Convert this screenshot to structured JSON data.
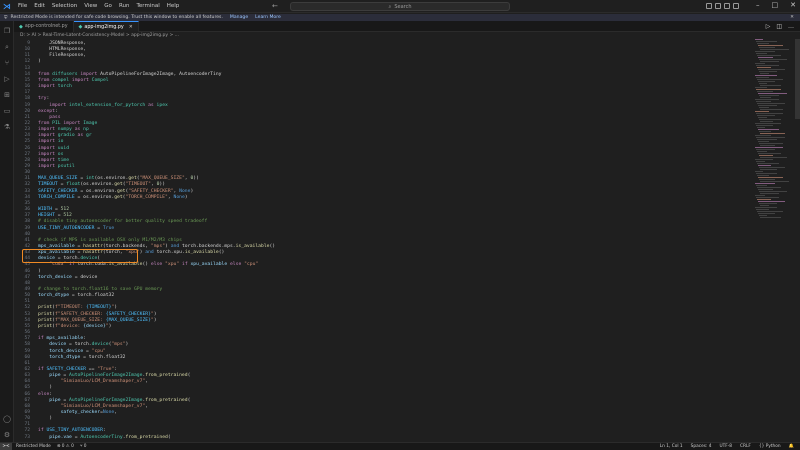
{
  "titlebar": {
    "logo": "vscode-logo",
    "menu": [
      "File",
      "Edit",
      "Selection",
      "View",
      "Go",
      "Run",
      "Terminal",
      "Help"
    ],
    "search_placeholder": "Search"
  },
  "restricted_banner": {
    "text": "Restricted Mode is intended for safe code browsing. Trust this window to enable all features.",
    "manage": "Manage",
    "learn_more": "Learn More"
  },
  "tabs": [
    {
      "label": "app-controlnet.py",
      "active": false
    },
    {
      "label": "app-img2img.py",
      "active": true
    }
  ],
  "breadcrumb": "D: > AI > Real-Time-Latent-Consistency-Model > app-img2img.py > ...",
  "status": {
    "remote": "><",
    "restricted": "Restricted Mode",
    "problems": "⊗ 0 ⚠ 0",
    "ports": "⑂ 0",
    "position": "Ln 1, Col 1",
    "spaces": "Spaces: 4",
    "encoding": "UTF-8",
    "eol": "CRLF",
    "language": "{} Python"
  },
  "code_lines": [
    {
      "n": "9",
      "t": [
        [
          "    JSONResponse,",
          "plain"
        ]
      ]
    },
    {
      "n": "10",
      "t": [
        [
          "    HTMLResponse,",
          "plain"
        ]
      ]
    },
    {
      "n": "11",
      "t": [
        [
          "    FileResponse,",
          "plain"
        ]
      ]
    },
    {
      "n": "12",
      "t": [
        [
          ")",
          "plain"
        ]
      ]
    },
    {
      "n": "13",
      "t": [
        [
          "",
          "plain"
        ]
      ]
    },
    {
      "n": "14",
      "t": [
        [
          "from ",
          "kw"
        ],
        [
          "diffusers ",
          "cls"
        ],
        [
          "import ",
          "kw"
        ],
        [
          "AutoPipelineForImage2Image, AutoencoderTiny",
          "plain"
        ]
      ]
    },
    {
      "n": "15",
      "t": [
        [
          "from ",
          "kw"
        ],
        [
          "compel ",
          "cls"
        ],
        [
          "import ",
          "kw"
        ],
        [
          "Compel",
          "cls"
        ]
      ]
    },
    {
      "n": "16",
      "t": [
        [
          "import ",
          "kw"
        ],
        [
          "torch",
          "cls"
        ]
      ]
    },
    {
      "n": "17",
      "t": [
        [
          "",
          "plain"
        ]
      ]
    },
    {
      "n": "18",
      "t": [
        [
          "try",
          "kw"
        ],
        [
          ":",
          "plain"
        ]
      ]
    },
    {
      "n": "19",
      "t": [
        [
          "    import ",
          "kw"
        ],
        [
          "intel_extension_for_pytorch ",
          "cls"
        ],
        [
          "as ",
          "kw"
        ],
        [
          "ipex",
          "cls"
        ]
      ]
    },
    {
      "n": "20",
      "t": [
        [
          "except",
          "kw"
        ],
        [
          ":",
          "plain"
        ]
      ]
    },
    {
      "n": "21",
      "t": [
        [
          "    pass",
          "kw"
        ]
      ]
    },
    {
      "n": "22",
      "t": [
        [
          "from ",
          "kw"
        ],
        [
          "PIL ",
          "cls"
        ],
        [
          "import ",
          "kw"
        ],
        [
          "Image",
          "cls"
        ]
      ]
    },
    {
      "n": "23",
      "t": [
        [
          "import ",
          "kw"
        ],
        [
          "numpy ",
          "cls"
        ],
        [
          "as ",
          "kw"
        ],
        [
          "np",
          "cls"
        ]
      ]
    },
    {
      "n": "24",
      "t": [
        [
          "import ",
          "kw"
        ],
        [
          "gradio ",
          "cls"
        ],
        [
          "as ",
          "kw"
        ],
        [
          "gr",
          "cls"
        ]
      ]
    },
    {
      "n": "25",
      "t": [
        [
          "import ",
          "kw"
        ],
        [
          "io",
          "cls"
        ]
      ]
    },
    {
      "n": "26",
      "t": [
        [
          "import ",
          "kw"
        ],
        [
          "uuid",
          "cls"
        ]
      ]
    },
    {
      "n": "27",
      "t": [
        [
          "import ",
          "kw"
        ],
        [
          "os",
          "cls"
        ]
      ]
    },
    {
      "n": "28",
      "t": [
        [
          "import ",
          "kw"
        ],
        [
          "time",
          "cls"
        ]
      ]
    },
    {
      "n": "29",
      "t": [
        [
          "import ",
          "kw"
        ],
        [
          "psutil",
          "cls"
        ]
      ]
    },
    {
      "n": "30",
      "t": [
        [
          "",
          "plain"
        ]
      ]
    },
    {
      "n": "31",
      "t": [
        [
          "MAX_QUEUE_SIZE",
          "cst"
        ],
        [
          " = ",
          "plain"
        ],
        [
          "int",
          "cls"
        ],
        [
          "(os.environ.",
          "plain"
        ],
        [
          "get",
          "fn"
        ],
        [
          "(",
          "plain"
        ],
        [
          "\"MAX_QUEUE_SIZE\"",
          "str"
        ],
        [
          ", ",
          "plain"
        ],
        [
          "0",
          "num"
        ],
        [
          "))",
          "plain"
        ]
      ]
    },
    {
      "n": "32",
      "t": [
        [
          "TIMEOUT",
          "cst"
        ],
        [
          " = ",
          "plain"
        ],
        [
          "float",
          "cls"
        ],
        [
          "(os.environ.",
          "plain"
        ],
        [
          "get",
          "fn"
        ],
        [
          "(",
          "plain"
        ],
        [
          "\"TIMEOUT\"",
          "str"
        ],
        [
          ", ",
          "plain"
        ],
        [
          "0",
          "num"
        ],
        [
          "))",
          "plain"
        ]
      ]
    },
    {
      "n": "33",
      "t": [
        [
          "SAFETY_CHECKER",
          "cst"
        ],
        [
          " = os.environ.",
          "plain"
        ],
        [
          "get",
          "fn"
        ],
        [
          "(",
          "plain"
        ],
        [
          "\"SAFETY_CHECKER\"",
          "str"
        ],
        [
          ", ",
          "plain"
        ],
        [
          "None",
          "kw2"
        ],
        [
          ")",
          "plain"
        ]
      ]
    },
    {
      "n": "34",
      "t": [
        [
          "TORCH_COMPILE",
          "cst"
        ],
        [
          " = os.environ.",
          "plain"
        ],
        [
          "get",
          "fn"
        ],
        [
          "(",
          "plain"
        ],
        [
          "\"TORCH_COMPILE\"",
          "str"
        ],
        [
          ", ",
          "plain"
        ],
        [
          "None",
          "kw2"
        ],
        [
          ")",
          "plain"
        ]
      ]
    },
    {
      "n": "35",
      "t": [
        [
          "",
          "plain"
        ]
      ]
    },
    {
      "n": "36",
      "t": [
        [
          "WIDTH",
          "cst"
        ],
        [
          " = ",
          "plain"
        ],
        [
          "512",
          "num"
        ]
      ]
    },
    {
      "n": "37",
      "t": [
        [
          "HEIGHT",
          "cst"
        ],
        [
          " = ",
          "plain"
        ],
        [
          "512",
          "num"
        ]
      ]
    },
    {
      "n": "38",
      "t": [
        [
          "# disable tiny autoencoder for better quality speed tradeoff",
          "cm"
        ]
      ]
    },
    {
      "n": "39",
      "t": [
        [
          "USE_TINY_AUTOENCODER",
          "cst"
        ],
        [
          " = ",
          "plain"
        ],
        [
          "True",
          "kw2"
        ]
      ]
    },
    {
      "n": "40",
      "t": [
        [
          "",
          "plain"
        ]
      ]
    },
    {
      "n": "41",
      "t": [
        [
          "# check if MPS is available OSX only M1/M2/M3 chips",
          "cm"
        ]
      ]
    },
    {
      "n": "42",
      "t": [
        [
          "mps_available",
          "id"
        ],
        [
          " = ",
          "plain"
        ],
        [
          "hasattr",
          "fn"
        ],
        [
          "(torch.backends, ",
          "plain"
        ],
        [
          "\"mps\"",
          "str"
        ],
        [
          ") ",
          "plain"
        ],
        [
          "and ",
          "kw2"
        ],
        [
          "torch.backends.mps.",
          "plain"
        ],
        [
          "is_available",
          "fn"
        ],
        [
          "()",
          "plain"
        ]
      ]
    },
    {
      "n": "43",
      "t": [
        [
          "xpu_available",
          "id"
        ],
        [
          " = ",
          "plain"
        ],
        [
          "hasattr",
          "fn"
        ],
        [
          "(torch, ",
          "plain"
        ],
        [
          "\"xpu\"",
          "str"
        ],
        [
          ") ",
          "plain"
        ],
        [
          "and ",
          "kw2"
        ],
        [
          "torch.xpu.",
          "plain"
        ],
        [
          "is_available",
          "fn"
        ],
        [
          "()",
          "plain"
        ]
      ]
    },
    {
      "n": "44",
      "t": [
        [
          "device",
          "id"
        ],
        [
          " = torch.",
          "plain"
        ],
        [
          "device",
          "cls"
        ],
        [
          "(",
          "plain"
        ]
      ]
    },
    {
      "n": "45",
      "t": [
        [
          "    ",
          "plain"
        ],
        [
          "\"cuda\"",
          "str"
        ],
        [
          " ",
          "plain"
        ],
        [
          "if ",
          "kw"
        ],
        [
          "torch.cuda.",
          "plain"
        ],
        [
          "is_available",
          "fn"
        ],
        [
          "() ",
          "plain"
        ],
        [
          "else ",
          "kw"
        ],
        [
          "\"xpu\"",
          "str"
        ],
        [
          " ",
          "plain"
        ],
        [
          "if ",
          "kw"
        ],
        [
          "xpu_available ",
          "id"
        ],
        [
          "else ",
          "kw"
        ],
        [
          "\"cpu\"",
          "str"
        ]
      ]
    },
    {
      "n": "46",
      "t": [
        [
          ")",
          "plain"
        ]
      ]
    },
    {
      "n": "47",
      "t": [
        [
          "torch_device",
          "id"
        ],
        [
          " = device",
          "plain"
        ]
      ]
    },
    {
      "n": "48",
      "t": [
        [
          "",
          "plain"
        ]
      ]
    },
    {
      "n": "49",
      "t": [
        [
          "# change to torch.float16 to save GPU memory",
          "cm"
        ]
      ]
    },
    {
      "n": "50",
      "t": [
        [
          "torch_dtype",
          "id"
        ],
        [
          " = torch.float32",
          "plain"
        ]
      ]
    },
    {
      "n": "51",
      "t": [
        [
          "",
          "plain"
        ]
      ]
    },
    {
      "n": "52",
      "t": [
        [
          "print",
          "fn"
        ],
        [
          "(",
          "plain"
        ],
        [
          "f\"TIMEOUT: ",
          "str"
        ],
        [
          "{TIMEOUT}",
          "cst"
        ],
        [
          "\"",
          "str"
        ],
        [
          ")",
          "plain"
        ]
      ]
    },
    {
      "n": "53",
      "t": [
        [
          "print",
          "fn"
        ],
        [
          "(",
          "plain"
        ],
        [
          "f\"SAFETY_CHECKER: ",
          "str"
        ],
        [
          "{SAFETY_CHECKER}",
          "cst"
        ],
        [
          "\"",
          "str"
        ],
        [
          ")",
          "plain"
        ]
      ]
    },
    {
      "n": "54",
      "t": [
        [
          "print",
          "fn"
        ],
        [
          "(",
          "plain"
        ],
        [
          "f\"MAX_QUEUE_SIZE: ",
          "str"
        ],
        [
          "{MAX_QUEUE_SIZE}",
          "cst"
        ],
        [
          "\"",
          "str"
        ],
        [
          ")",
          "plain"
        ]
      ]
    },
    {
      "n": "55",
      "t": [
        [
          "print",
          "fn"
        ],
        [
          "(",
          "plain"
        ],
        [
          "f\"device: ",
          "str"
        ],
        [
          "{device}",
          "id"
        ],
        [
          "\"",
          "str"
        ],
        [
          ")",
          "plain"
        ]
      ]
    },
    {
      "n": "56",
      "t": [
        [
          "",
          "plain"
        ]
      ]
    },
    {
      "n": "57",
      "t": [
        [
          "if ",
          "kw"
        ],
        [
          "mps_available",
          "id"
        ],
        [
          ":",
          "plain"
        ]
      ]
    },
    {
      "n": "58",
      "t": [
        [
          "    device",
          "id"
        ],
        [
          " = torch.",
          "plain"
        ],
        [
          "device",
          "cls"
        ],
        [
          "(",
          "plain"
        ],
        [
          "\"mps\"",
          "str"
        ],
        [
          ")",
          "plain"
        ]
      ]
    },
    {
      "n": "59",
      "t": [
        [
          "    torch_device",
          "id"
        ],
        [
          " = ",
          "plain"
        ],
        [
          "\"cpu\"",
          "str"
        ]
      ]
    },
    {
      "n": "60",
      "t": [
        [
          "    torch_dtype",
          "id"
        ],
        [
          " = torch.float32",
          "plain"
        ]
      ]
    },
    {
      "n": "61",
      "t": [
        [
          "",
          "plain"
        ]
      ]
    },
    {
      "n": "62",
      "t": [
        [
          "if ",
          "kw"
        ],
        [
          "SAFETY_CHECKER",
          "cst"
        ],
        [
          " == ",
          "plain"
        ],
        [
          "\"True\"",
          "str"
        ],
        [
          ":",
          "plain"
        ]
      ]
    },
    {
      "n": "63",
      "t": [
        [
          "    pipe",
          "id"
        ],
        [
          " = ",
          "plain"
        ],
        [
          "AutoPipelineForImage2Image",
          "cls"
        ],
        [
          ".",
          "plain"
        ],
        [
          "from_pretrained",
          "fn"
        ],
        [
          "(",
          "plain"
        ]
      ]
    },
    {
      "n": "64",
      "t": [
        [
          "        ",
          "plain"
        ],
        [
          "\"SimianLuo/LCM_Dreamshaper_v7\"",
          "str"
        ],
        [
          ",",
          "plain"
        ]
      ]
    },
    {
      "n": "65",
      "t": [
        [
          "    )",
          "plain"
        ]
      ]
    },
    {
      "n": "66",
      "t": [
        [
          "else",
          "kw"
        ],
        [
          ":",
          "plain"
        ]
      ]
    },
    {
      "n": "67",
      "t": [
        [
          "    pipe",
          "id"
        ],
        [
          " = ",
          "plain"
        ],
        [
          "AutoPipelineForImage2Image",
          "cls"
        ],
        [
          ".",
          "plain"
        ],
        [
          "from_pretrained",
          "fn"
        ],
        [
          "(",
          "plain"
        ]
      ]
    },
    {
      "n": "68",
      "t": [
        [
          "        ",
          "plain"
        ],
        [
          "\"SimianLuo/LCM_Dreamshaper_v7\"",
          "str"
        ],
        [
          ",",
          "plain"
        ]
      ]
    },
    {
      "n": "69",
      "t": [
        [
          "        safety_checker",
          "id"
        ],
        [
          "=",
          "plain"
        ],
        [
          "None",
          "kw2"
        ],
        [
          ",",
          "plain"
        ]
      ]
    },
    {
      "n": "70",
      "t": [
        [
          "    )",
          "plain"
        ]
      ]
    },
    {
      "n": "71",
      "t": [
        [
          "",
          "plain"
        ]
      ]
    },
    {
      "n": "72",
      "t": [
        [
          "if ",
          "kw"
        ],
        [
          "USE_TINY_AUTOENCODER",
          "cst"
        ],
        [
          ":",
          "plain"
        ]
      ]
    },
    {
      "n": "73",
      "t": [
        [
          "    pipe.vae",
          "id"
        ],
        [
          " = ",
          "plain"
        ],
        [
          "AutoencoderTiny",
          "cls"
        ],
        [
          ".",
          "plain"
        ],
        [
          "from_pretrained",
          "fn"
        ],
        [
          "(",
          "plain"
        ]
      ]
    }
  ]
}
